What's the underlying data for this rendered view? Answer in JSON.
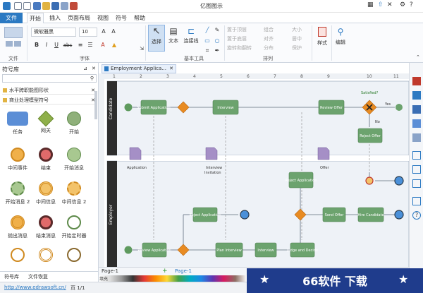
{
  "window": {
    "title": "亿图图示"
  },
  "tabs": [
    {
      "label": "文件"
    },
    {
      "label": "开始"
    },
    {
      "label": "插入"
    },
    {
      "label": "页面布局"
    },
    {
      "label": "视图"
    },
    {
      "label": "符号"
    },
    {
      "label": "帮助"
    }
  ],
  "ribbon": {
    "font_name": "微软雅黑",
    "font_size": "10",
    "bold": "B",
    "italic": "I",
    "underline": "U",
    "abc": "abc",
    "groups": {
      "file": "文件",
      "font": "字体",
      "basic_tools": "基本工具",
      "arrange": "排列"
    },
    "select": "选择",
    "text": "文本",
    "connector": "连接线",
    "arrange_items": [
      "置于顶层",
      "置于底层",
      "旋转和翻转",
      "组合",
      "对齐",
      "分布",
      "大小",
      "居中",
      "保护"
    ],
    "style": "样式",
    "edit": "编辑"
  },
  "library": {
    "title": "符号库",
    "items": [
      {
        "label": "水平跨职能图形状"
      },
      {
        "label": "商业处理模型符号"
      }
    ],
    "shapes": [
      "任务",
      "网关",
      "开始",
      "中间事件",
      "结束",
      "开始消息",
      "开始消息 2",
      "中间信息",
      "中间信息 2",
      "抛出消息",
      "结束消息",
      "开始定时器"
    ],
    "bottom_tabs": [
      "符号库",
      "文件恢复"
    ]
  },
  "document": {
    "tab": "Employment Applica..."
  },
  "diagram": {
    "lanes": [
      "Candidate",
      "Employer"
    ],
    "nodes": [
      "Submit Application",
      "Interview",
      "Review Offer",
      "Reject Offer",
      "Reject Application",
      "Reject Application",
      "Send Offer",
      "Hire Candidate",
      "Review Application",
      "Plan Interview",
      "Interview",
      "Judge and Decide"
    ],
    "labels": {
      "satisfied": "Satisfied?",
      "no": "No",
      "yes": "Yes",
      "application": "Application",
      "interview_invitation": "Interview Invitation",
      "offer": "Offer"
    }
  },
  "ruler": {
    "ticks": [
      "1",
      "2",
      "3",
      "4",
      "5",
      "6",
      "7",
      "8",
      "9",
      "10",
      "11"
    ]
  },
  "pagebar": {
    "page_select": "Page-1",
    "page_tab": "Page-1",
    "add": "+"
  },
  "palette_label": "填充",
  "status": {
    "url": "http://www.edrawsoft.cn/",
    "page": "页 1/1"
  },
  "watermark": {
    "text": "66软件 下载"
  },
  "colors": {
    "accent": "#2b79c2",
    "task": "#6ca36e",
    "gateway": "#e88b22",
    "lane": "#2d2d2d",
    "banner": "#1f3c8c"
  }
}
